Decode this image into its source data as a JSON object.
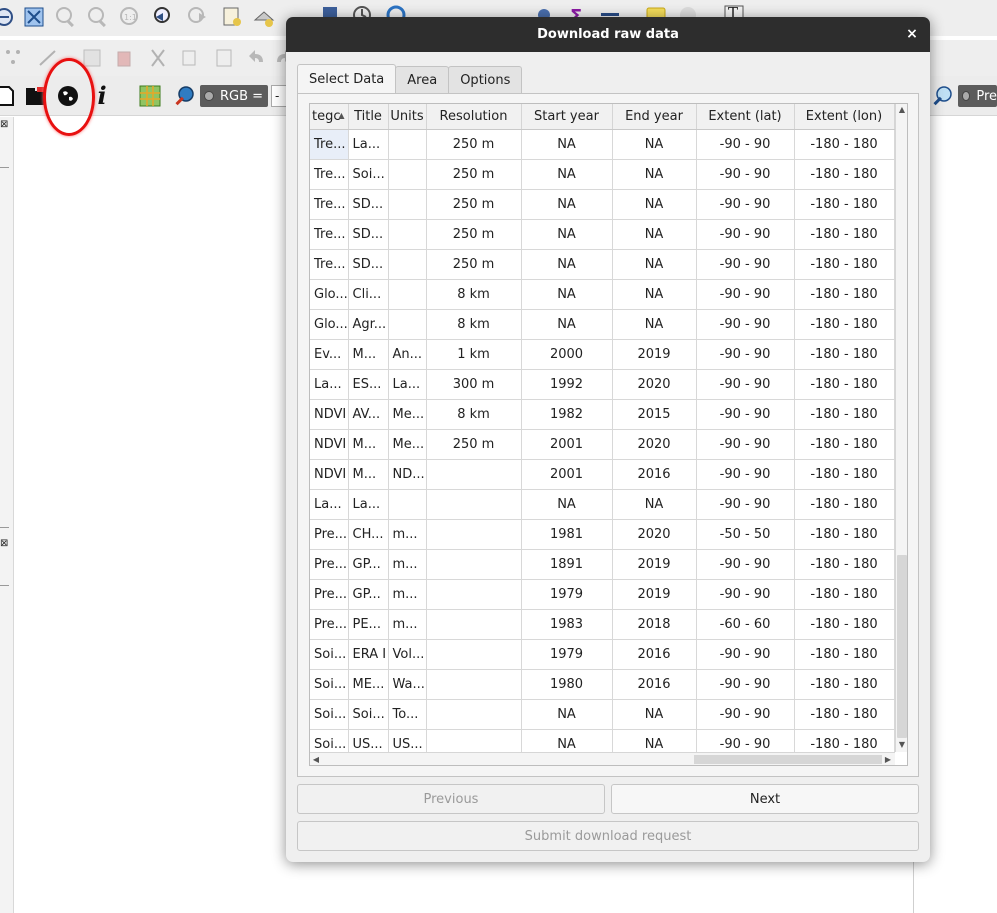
{
  "dialog": {
    "title": "Download raw data",
    "close_glyph": "×",
    "tabs": [
      "Select Data",
      "Area",
      "Options"
    ],
    "active_tab": "Select Data",
    "buttons": {
      "previous": "Previous",
      "next": "Next",
      "submit": "Submit download request"
    }
  },
  "table": {
    "headers": [
      "tegc",
      "Title",
      "Units",
      "Resolution",
      "Start year",
      "End year",
      "Extent (lat)",
      "Extent (lon)"
    ],
    "sort_indicator": "▲",
    "rows": [
      [
        "Tre...",
        "La...",
        "",
        "250 m",
        "NA",
        "NA",
        "-90 - 90",
        "-180 - 180"
      ],
      [
        "Tre...",
        "Soi...",
        "",
        "250 m",
        "NA",
        "NA",
        "-90 - 90",
        "-180 - 180"
      ],
      [
        "Tre...",
        "SD...",
        "",
        "250 m",
        "NA",
        "NA",
        "-90 - 90",
        "-180 - 180"
      ],
      [
        "Tre...",
        "SD...",
        "",
        "250 m",
        "NA",
        "NA",
        "-90 - 90",
        "-180 - 180"
      ],
      [
        "Tre...",
        "SD...",
        "",
        "250 m",
        "NA",
        "NA",
        "-90 - 90",
        "-180 - 180"
      ],
      [
        "Glo...",
        "Cli...",
        "",
        "8 km",
        "NA",
        "NA",
        "-90 - 90",
        "-180 - 180"
      ],
      [
        "Glo...",
        "Agr...",
        "",
        "8 km",
        "NA",
        "NA",
        "-90 - 90",
        "-180 - 180"
      ],
      [
        "Ev...",
        "M...",
        "An...",
        "1 km",
        "2000",
        "2019",
        "-90 - 90",
        "-180 - 180"
      ],
      [
        "La...",
        "ES...",
        "La...",
        "300 m",
        "1992",
        "2020",
        "-90 - 90",
        "-180 - 180"
      ],
      [
        "NDVI",
        "AV...",
        "Me...",
        "8 km",
        "1982",
        "2015",
        "-90 - 90",
        "-180 - 180"
      ],
      [
        "NDVI",
        "M...",
        "Me...",
        "250 m",
        "2001",
        "2020",
        "-90 - 90",
        "-180 - 180"
      ],
      [
        "NDVI",
        "M...",
        "ND...",
        "",
        "2001",
        "2016",
        "-90 - 90",
        "-180 - 180"
      ],
      [
        "La...",
        "La...",
        "",
        "",
        "NA",
        "NA",
        "-90 - 90",
        "-180 - 180"
      ],
      [
        "Pre...",
        "CH...",
        "m...",
        "",
        "1981",
        "2020",
        "-50 - 50",
        "-180 - 180"
      ],
      [
        "Pre...",
        "GP...",
        "m...",
        "",
        "1891",
        "2019",
        "-90 - 90",
        "-180 - 180"
      ],
      [
        "Pre...",
        "GP...",
        "m...",
        "",
        "1979",
        "2019",
        "-90 - 90",
        "-180 - 180"
      ],
      [
        "Pre...",
        "PE...",
        "m...",
        "",
        "1983",
        "2018",
        "-60 - 60",
        "-180 - 180"
      ],
      [
        "Soi...",
        "ERA I",
        "Vol...",
        "",
        "1979",
        "2016",
        "-90 - 90",
        "-180 - 180"
      ],
      [
        "Soi...",
        "ME...",
        "Wa...",
        "",
        "1980",
        "2016",
        "-90 - 90",
        "-180 - 180"
      ],
      [
        "Soi...",
        "Soi...",
        "To...",
        "",
        "NA",
        "NA",
        "-90 - 90",
        "-180 - 180"
      ],
      [
        "Soi...",
        "US...",
        "US...",
        "",
        "NA",
        "NA",
        "-90 - 90",
        "-180 - 180"
      ]
    ],
    "scroll_glyphs": {
      "up": "▲",
      "down": "▼",
      "left": "◀",
      "right": "▶"
    }
  },
  "toolbar": {
    "layer_selector_label": "RGB =",
    "layer_value": "-",
    "right_selector_label": "Pre",
    "text_tool_glyph": "T",
    "info_glyph": "i"
  },
  "panels": {
    "close_glyph": "⊠"
  },
  "colors": {
    "titlebar": "#2d2d2d",
    "annotation_ring": "#e81010",
    "selector_bg": "#5c5c5c"
  },
  "icons": [
    "zoom-full-icon",
    "zoom-in-icon",
    "zoom-out-icon",
    "zoom-native-icon",
    "zoom-last-icon",
    "zoom-next-icon",
    "new-map-view-icon",
    "temporal-controller-icon",
    "open-project-icon",
    "new-folder-icon",
    "globe-download-icon",
    "info-icon",
    "plugin-grid-icon",
    "search-layer-icon",
    "zoom-to-layer-icon"
  ]
}
